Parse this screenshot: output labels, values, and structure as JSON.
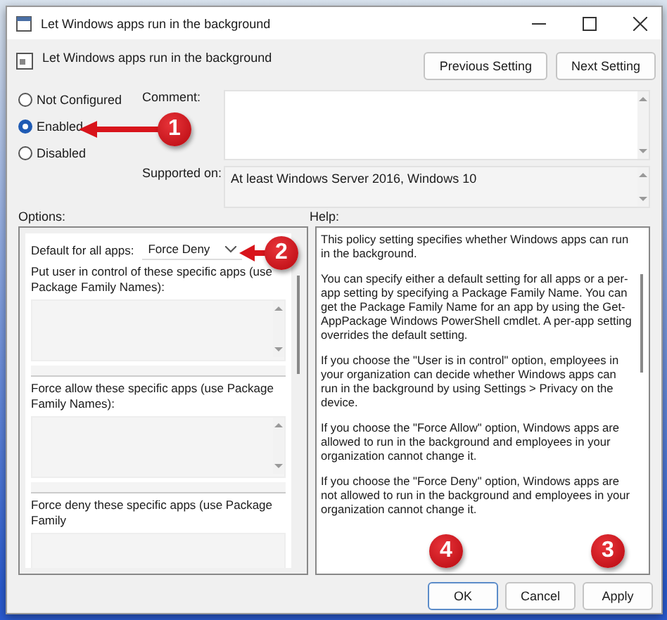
{
  "window": {
    "title": "Let Windows apps run in the background"
  },
  "header": {
    "policy_name": "Let Windows apps run in the background",
    "buttons": [
      "Previous Setting",
      "Next Setting"
    ]
  },
  "states": [
    {
      "label": "Not Configured",
      "selected": false
    },
    {
      "label": "Enabled",
      "selected": true
    },
    {
      "label": "Disabled",
      "selected": false
    }
  ],
  "comment": {
    "label": "Comment:"
  },
  "supported_on": {
    "label": "Supported on:",
    "value": "At least Windows Server 2016, Windows 10"
  },
  "options": {
    "label": "Options:",
    "default_label": "Default for all apps:",
    "default_value": "Force Deny",
    "lists": [
      {
        "label": "Put user in control of these specific apps (use Package Family Names):"
      },
      {
        "label": "Force allow these specific apps (use Package Family Names):"
      },
      {
        "label": "Force deny these specific apps (use Package Family"
      }
    ]
  },
  "help": {
    "label": "Help:",
    "paragraphs": [
      "This policy setting specifies whether Windows apps can run in the background.",
      "You can specify either a default setting for all apps or a per-app setting by specifying a Package Family Name. You can get the Package Family Name for an app by using the Get-AppPackage Windows PowerShell cmdlet. A per-app setting overrides the default setting.",
      "If you choose the \"User is in control\" option, employees in your organization can decide whether Windows apps can run in the background by using Settings > Privacy on the device.",
      "If you choose the \"Force Allow\" option, Windows apps are allowed to run in the background and employees in your organization cannot change it.",
      "If you choose the \"Force Deny\" option, Windows apps are not allowed to run in the background and employees in your organization cannot change it."
    ]
  },
  "footer": {
    "buttons": [
      "OK",
      "Cancel",
      "Apply"
    ]
  },
  "callouts": [
    {
      "label": "1"
    },
    {
      "label": "2"
    },
    {
      "label": "3"
    },
    {
      "label": "4"
    }
  ]
}
